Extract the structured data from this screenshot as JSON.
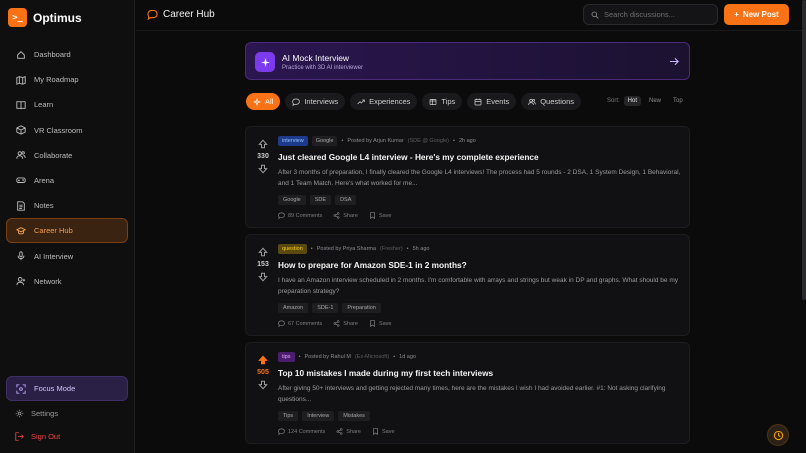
{
  "app": {
    "logo_glyph": ">_",
    "name": "Optimus"
  },
  "sidebar": {
    "items": [
      {
        "label": "Dashboard",
        "icon": "grid-icon"
      },
      {
        "label": "My Roadmap",
        "icon": "map-icon"
      },
      {
        "label": "Learn",
        "icon": "book-icon"
      },
      {
        "label": "VR Classroom",
        "icon": "cube-icon"
      },
      {
        "label": "Collaborate",
        "icon": "users-icon"
      },
      {
        "label": "Arena",
        "icon": "gamepad-icon"
      },
      {
        "label": "Notes",
        "icon": "note-icon"
      },
      {
        "label": "Career Hub",
        "icon": "graduation-cap-icon",
        "active": true
      },
      {
        "label": "AI Interview",
        "icon": "mic-icon"
      },
      {
        "label": "Network",
        "icon": "user-plus-icon"
      }
    ],
    "focus_mode": "Focus Mode",
    "settings": "Settings",
    "sign_out": "Sign Out"
  },
  "header": {
    "title": "Career Hub",
    "search_placeholder": "Search discussions...",
    "new_post": "New Post"
  },
  "banner": {
    "title": "AI Mock Interview",
    "subtitle": "Practice with 3D AI interviewer"
  },
  "filters": [
    {
      "label": "All",
      "icon": "sparkle-icon",
      "active": true
    },
    {
      "label": "Interviews",
      "icon": "chat-icon"
    },
    {
      "label": "Experiences",
      "icon": "trend-icon"
    },
    {
      "label": "Tips",
      "icon": "box-icon"
    },
    {
      "label": "Events",
      "icon": "calendar-icon"
    },
    {
      "label": "Questions",
      "icon": "users-icon"
    }
  ],
  "sort": {
    "label": "Sort:",
    "options": [
      "Hot",
      "New",
      "Top"
    ],
    "selected": "Hot"
  },
  "posts": [
    {
      "type": "interview",
      "company": "Google",
      "author": "Posted by Arjun Kumar",
      "role": "(SDE @ Google)",
      "time": "2h ago",
      "votes": "330",
      "title": "Just cleared Google L4 interview - Here's my complete experience",
      "body": "After 3 months of preparation, I finally cleared the Google L4 interviews! The process had 5 rounds - 2 DSA, 1 System Design, 1 Behavioral, and 1 Team Match. Here's what worked for me...",
      "tags": [
        "Google",
        "SDE",
        "DSA"
      ],
      "comments": "89 Comments",
      "share": "Share",
      "save": "Save"
    },
    {
      "type": "question",
      "company": "",
      "author": "Posted by Priya Sharma",
      "role": "(Fresher)",
      "time": "5h ago",
      "votes": "153",
      "title": "How to prepare for Amazon SDE-1 in 2 months?",
      "body": "I have an Amazon interview scheduled in 2 months. I'm comfortable with arrays and strings but weak in DP and graphs. What should be my preparation strategy?",
      "tags": [
        "Amazon",
        "SDE-1",
        "Preparation"
      ],
      "comments": "67 Comments",
      "share": "Share",
      "save": "Save"
    },
    {
      "type": "tips",
      "company": "",
      "author": "Posted by Rahul M",
      "role": "(Ex-Microsoft)",
      "time": "1d ago",
      "votes": "505",
      "title": "Top 10 mistakes I made during my first tech interviews",
      "body": "After giving 50+ interviews and getting rejected many times, here are the mistakes I wish I had avoided earlier. #1: Not asking clarifying questions...",
      "tags": [
        "Tips",
        "Interview",
        "Mistakes"
      ],
      "comments": "124 Comments",
      "share": "Share",
      "save": "Save"
    }
  ],
  "colors": {
    "accent": "#f97316",
    "interview_badge": "#1e3a8a",
    "question_badge": "#5a4a10",
    "tips_badge": "#4c1d6e"
  }
}
